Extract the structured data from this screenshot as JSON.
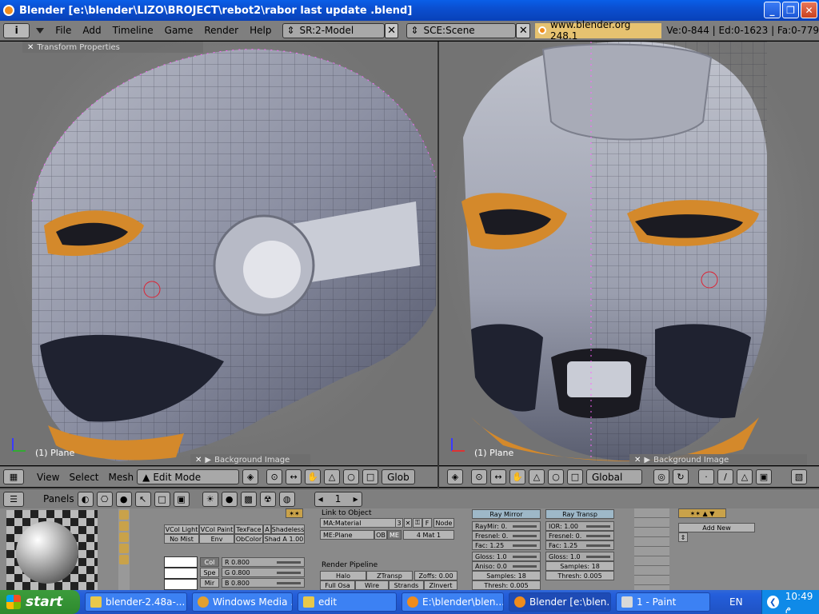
{
  "window": {
    "title": "Blender [e:\\blender\\LIZO\\BROJECT\\rebot2\\rabor last update .blend]",
    "buttons": {
      "minimize": "_",
      "maximize": "❐",
      "close": "✕"
    }
  },
  "menubar": {
    "info_icon": "i",
    "menus": [
      "File",
      "Add",
      "Timeline",
      "Game",
      "Render",
      "Help"
    ],
    "screen": "SR:2-Model",
    "scene": "SCE:Scene",
    "url": "www.blender.org 248.1",
    "stats": "Ve:0-844 | Ed:0-1623 | Fa:0-779"
  },
  "viewports": {
    "left": {
      "panel_tab": "Transform Properties",
      "object_label": "(1) Plane",
      "bg_tab": "Background Image"
    },
    "right": {
      "object_label": "(1) Plane",
      "bg_tab": "Background Image"
    }
  },
  "view_header_left": {
    "menus": [
      "View",
      "Select",
      "Mesh"
    ],
    "mode": "Edit Mode",
    "orientation": "Glob"
  },
  "view_header_right": {
    "orientation": "Global"
  },
  "buttons_header": {
    "panels_label": "Panels",
    "frame": "1"
  },
  "buttons_window": {
    "material_toggles": [
      "VCol Light",
      "VCol Paint",
      "TexFace",
      "A",
      "Shadeless",
      "No Mist",
      "Env",
      "ObColor",
      "Shad A 1.00"
    ],
    "color_tabs": [
      "Col",
      "Spe",
      "Mir"
    ],
    "rgb": [
      "R 0.800",
      "G 0.800",
      "B 0.800"
    ],
    "link_title": "Link to Object",
    "material_name": "MA:Material",
    "users": "3",
    "node_label": "Node",
    "f_label": "F",
    "me_label": "ME:Plane",
    "ob_label": "OB",
    "me2_label": "ME",
    "mat_slot": "4 Mat 1",
    "render_pipeline_title": "Render Pipeline",
    "pipeline_buttons": [
      "Halo",
      "ZTransp",
      "Zoffs: 0.00",
      "Full Osa",
      "Wire",
      "Strands",
      "ZInvert"
    ],
    "ray_mirror": "Ray Mirror",
    "ray_transp": "Ray Transp",
    "mirror_fields": [
      "RayMir: 0.",
      "Fresnel: 0.",
      "Fac: 1.25",
      "Gloss: 1.0",
      "Aniso: 0.0",
      "Samples: 18",
      "Thresh: 0.005"
    ],
    "transp_fields": [
      "IOR: 1.00",
      "Fresnel: 0.",
      "Fac: 1.25",
      "Gloss: 1.0",
      "Samples: 18",
      "Thresh: 0.005"
    ],
    "add_new": "Add New"
  },
  "taskbar": {
    "start_label": "start",
    "tasks": [
      {
        "label": "blender-2.48a-...",
        "icon_color": "#e8c84a"
      },
      {
        "label": "Windows Media ...",
        "icon_color": "#e2a030"
      },
      {
        "label": "edit",
        "icon_color": "#e8c84a"
      },
      {
        "label": "E:\\blender\\blen...",
        "icon_color": "#f08c1c"
      },
      {
        "label": "Blender [e:\\blen...",
        "icon_color": "#f08c1c"
      },
      {
        "label": "1 - Paint",
        "icon_color": "#d8d8d8"
      }
    ],
    "language": "EN",
    "clock": "10:49 م"
  }
}
